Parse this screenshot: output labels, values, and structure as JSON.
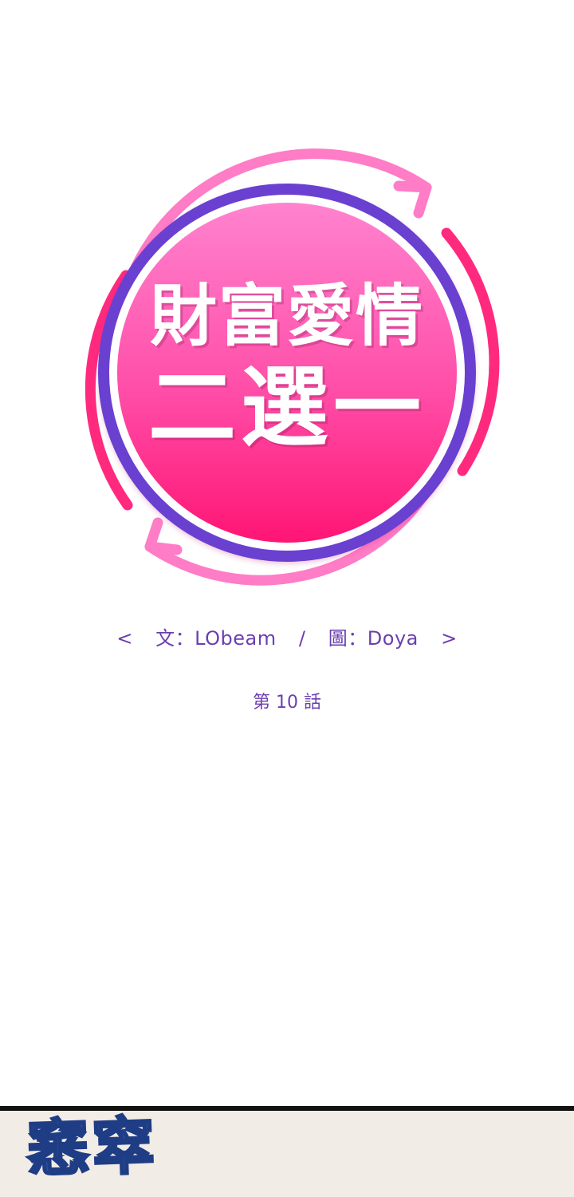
{
  "title": {
    "line1": "財富愛情",
    "line2": "二選一"
  },
  "credits": {
    "open": "<",
    "writer_label": "文：LObeam",
    "sep": "/",
    "artist_label": "圖：Doya",
    "close": ">"
  },
  "episode": "第 10 話",
  "panel": {
    "sfx": "窸窣"
  },
  "colors": {
    "ring_pink": "#ff3d8b",
    "ring_light_pink": "#ff7ac0",
    "ring_purple": "#6a3fd0",
    "disc_top": "#ff7ac8",
    "disc_bottom": "#ff1a78",
    "credit_text": "#6b3fb0",
    "sfx_blue": "#3d63b8"
  }
}
